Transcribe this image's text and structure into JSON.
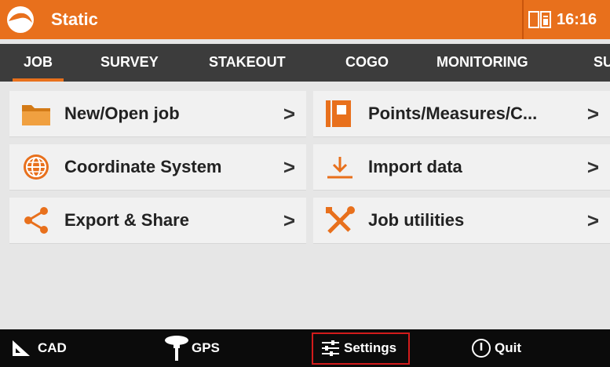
{
  "app": {
    "title": "Static",
    "time": "16:16"
  },
  "tabs": [
    {
      "label": "JOB",
      "active": true
    },
    {
      "label": "SURVEY"
    },
    {
      "label": "STAKEOUT"
    },
    {
      "label": "COGO"
    },
    {
      "label": "MONITORING"
    },
    {
      "label": "SU"
    }
  ],
  "menu": {
    "items": [
      {
        "label": "New/Open job",
        "icon": "folder-icon"
      },
      {
        "label": "Points/Measures/C...",
        "icon": "book-icon"
      },
      {
        "label": "Coordinate System",
        "icon": "globe-icon"
      },
      {
        "label": "Import data",
        "icon": "download-icon"
      },
      {
        "label": "Export & Share",
        "icon": "share-icon"
      },
      {
        "label": "Job utilities",
        "icon": "tools-icon"
      }
    ],
    "chevron": ">"
  },
  "bottom": {
    "cad": "CAD",
    "gps": "GPS",
    "settings": "Settings",
    "quit": "Quit"
  },
  "colors": {
    "accent": "#e8701c",
    "tabs_bg": "#3c3c3c",
    "bottom_bg": "#0b0b0b",
    "highlight": "#d21b1b"
  }
}
